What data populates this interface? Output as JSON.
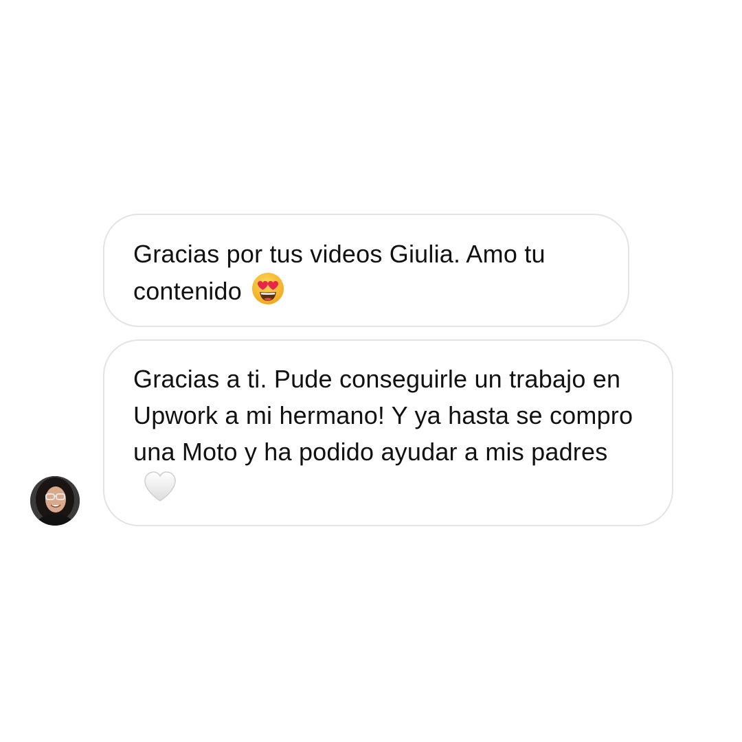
{
  "conversation": {
    "messages": [
      {
        "text": "Gracias por tus videos Giulia. Amo tu contenido",
        "emoji": "heart-eyes-emoji"
      },
      {
        "text": "Gracias a ti. Pude conseguirle un trabajo en Upwork a mi hermano! Y ya hasta se compro una Moto y ha podido ayudar a mis padres",
        "emoji": "white-heart-emoji"
      }
    ],
    "sender_avatar": "sender-avatar-photo"
  },
  "colors": {
    "background": "#ffffff",
    "bubble_border": "#e3e3e3",
    "text": "#111111",
    "emoji_face": "#f5b726",
    "emoji_heart_red": "#e8264a",
    "white_heart": "#f2f2f2"
  }
}
